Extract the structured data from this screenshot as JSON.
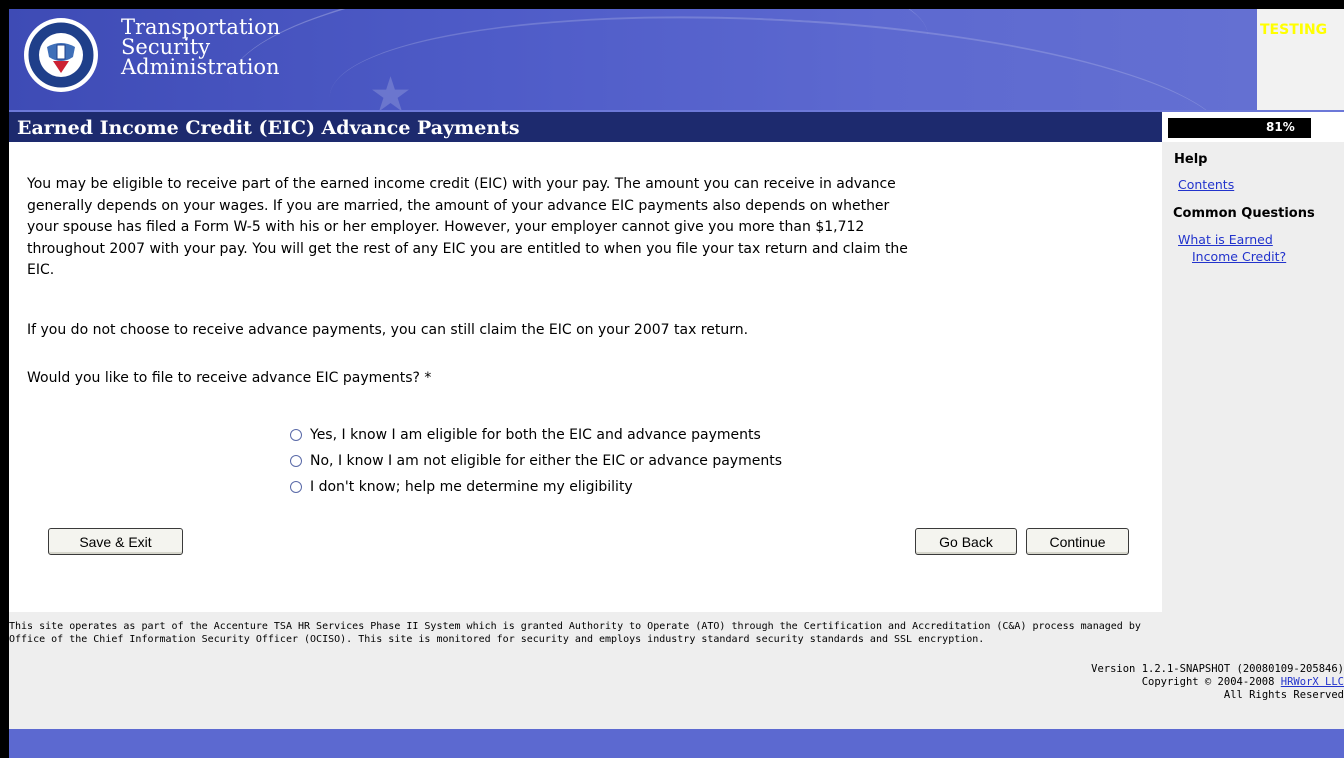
{
  "header": {
    "agency_line1": "Transportation",
    "agency_line2": "Security",
    "agency_line3": "Administration",
    "seal_icon": "dhs-seal-icon",
    "environment_badge": "TESTING"
  },
  "page": {
    "title": "Earned Income Credit (EIC) Advance Payments",
    "progress_value": 0.81,
    "progress_label": "81%"
  },
  "content": {
    "para1_line1": "You may be eligible to receive part of the earned income credit (EIC) with your pay. The amount you can receive in advance",
    "para1_line2": "generally depends on your wages. If you are married, the amount of your advance EIC payments also depends on whether",
    "para1_line3": "your spouse has filed a Form W-5 with his or her employer. However, your employer cannot give you more than $1,712",
    "para1_line4": "throughout 2007 with your pay. You will get the rest of any EIC you are entitled to when you file your tax return and claim the",
    "para1_line5": "EIC.",
    "para2": "If you do not choose to receive advance payments, you can still claim the EIC on your 2007 tax return.",
    "question": "Would you like to file to receive advance EIC payments? *",
    "options": [
      "Yes, I know I am eligible for both the EIC and advance payments",
      "No, I know I am not eligible for either the EIC or advance payments",
      "I don't know; help me determine my eligibility"
    ],
    "selected_option": null
  },
  "buttons": {
    "save_exit": "Save & Exit",
    "go_back": "Go Back",
    "continue": "Continue"
  },
  "sidebar": {
    "help_heading": "Help",
    "contents_link": "Contents",
    "common_questions_heading": "Common Questions",
    "question_link_line1": "What is Earned",
    "question_link_line2": "Income Credit?"
  },
  "footer": {
    "notice_line1": "This site operates as part of the Accenture TSA HR Services Phase II System which is granted Authority to Operate (ATO) through the Certification and Accreditation (C&A) process managed by",
    "notice_line2": "Office of the Chief Information Security Officer (OCISO). This site is monitored for security and employs industry standard security standards and SSL encryption.",
    "version": "Version 1.2.1-SNAPSHOT (20080109-205846)",
    "copyright_prefix": "Copyright © 2004-2008 ",
    "copyright_link": "HRWorX LLC",
    "rights": "All Rights Reserved"
  },
  "colors": {
    "banner": "#4f5cc8",
    "title_bar": "#1d2a6e",
    "link": "#2233cc",
    "sidebar_bg": "#eeeeee",
    "testing": "#ffff00"
  }
}
